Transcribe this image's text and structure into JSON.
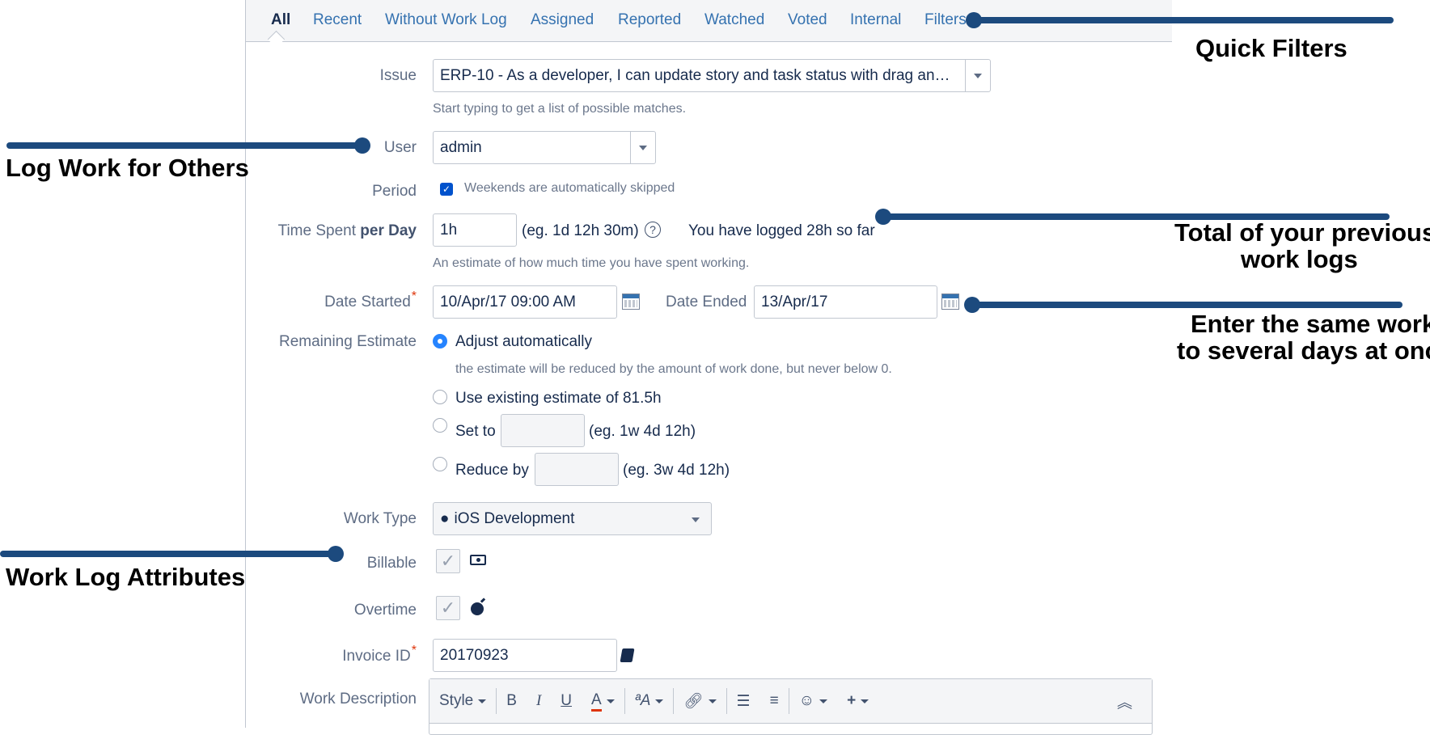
{
  "tabs": [
    "All",
    "Recent",
    "Without Work Log",
    "Assigned",
    "Reported",
    "Watched",
    "Voted",
    "Internal",
    "Filters"
  ],
  "issue": {
    "label": "Issue",
    "value": "ERP-10 - As a developer, I can update story and task status with drag an…",
    "help": "Start typing to get a list of possible matches."
  },
  "user": {
    "label": "User",
    "value": "admin"
  },
  "period": {
    "label": "Period",
    "checkbox_text": "Weekends are automatically skipped"
  },
  "time_spent": {
    "label_prefix": "Time Spent ",
    "label_bold": "per Day",
    "value": "1h",
    "example": "(eg. 1d 12h 30m)",
    "help_icon": "?",
    "logged": "You have logged 28h so far",
    "help": "An estimate of how much time you have spent working."
  },
  "date_started": {
    "label": "Date Started",
    "required": "*",
    "value": "10/Apr/17 09:00 AM"
  },
  "date_ended": {
    "label": "Date Ended",
    "value": "13/Apr/17"
  },
  "remaining": {
    "label": "Remaining Estimate",
    "adjust": "Adjust automatically",
    "adjust_help": "the estimate will be reduced by the amount of work done, but never below 0.",
    "existing": "Use existing estimate of 81.5h",
    "set_to": "Set to",
    "set_to_example": "(eg. 1w 4d 12h)",
    "reduce_by": "Reduce by",
    "reduce_by_example": "(eg. 3w 4d 12h)"
  },
  "work_type": {
    "label": "Work Type",
    "value": "iOS Development"
  },
  "billable": {
    "label": "Billable"
  },
  "overtime": {
    "label": "Overtime"
  },
  "invoice": {
    "label": "Invoice ID",
    "required": "*",
    "value": "20170923"
  },
  "work_description": {
    "label": "Work Description",
    "toolbar": {
      "style": "Style",
      "bold": "B",
      "italic": "I",
      "underline": "U",
      "color": "A"
    }
  },
  "annotations": {
    "quick_filters": "Quick Filters",
    "log_work_others": "Log Work for Others",
    "total_previous_1": "Total of your previous",
    "total_previous_2": "work logs",
    "enter_same_1": "Enter the same work",
    "enter_same_2": "to several days at once",
    "attributes": "Work Log Attributes"
  },
  "colors": {
    "annotation": "#1c4a7e",
    "link": "#3572b0",
    "checkbox": "#0052cc",
    "radio": "#2684ff"
  },
  "icons": [
    "dropdown-caret",
    "calendar-icon",
    "help-icon",
    "apple-icon",
    "money-icon",
    "bomb-icon",
    "book-icon"
  ]
}
